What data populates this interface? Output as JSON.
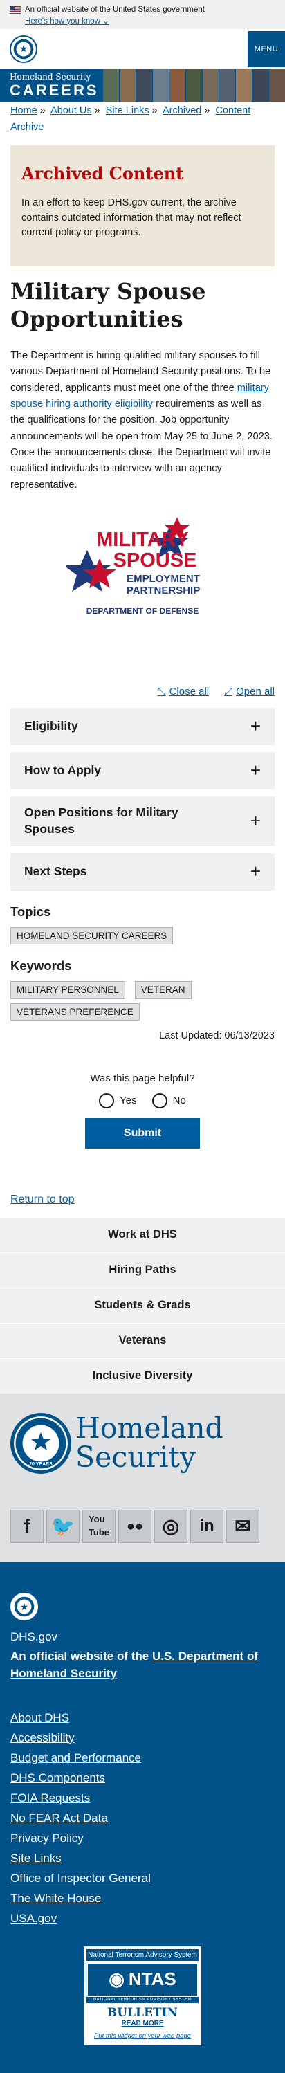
{
  "gov_banner": {
    "text": "An official website of the United States government",
    "link": "Here's how you know"
  },
  "header": {
    "menu": "MENU",
    "small_title": "Homeland Security",
    "careers": "CAREERS"
  },
  "breadcrumb": [
    "Home",
    "About Us",
    "Site Links",
    "Archived",
    "Content Archive"
  ],
  "archive": {
    "title": "Archived Content",
    "text": "In an effort to keep DHS.gov current, the archive contains outdated information that may not reflect current policy or programs."
  },
  "page_title": "Military Spouse Opportunities",
  "lead": {
    "before": "The Department is hiring qualified military spouses to fill various Department of Homeland Security positions. To be considered, applicants must meet one of the three ",
    "link": "military spouse hiring authority eligibility",
    "after": " requirements as well as the qualifications for the position. Job opportunity announcements will be open from May 25 to June 2, 2023. Once the announcements close, the Department will invite qualified individuals to interview with an agency representative."
  },
  "logo": {
    "line1": "MILITARY",
    "line2": "SPOUSE",
    "line3": "EMPLOYMENT",
    "line4": "PARTNERSHIP",
    "line5": "DEPARTMENT OF DEFENSE"
  },
  "accordion": {
    "close_all": "Close all",
    "open_all": "Open all",
    "items": [
      "Eligibility",
      "How to Apply",
      "Open Positions for Military Spouses",
      "Next Steps"
    ]
  },
  "topics": {
    "heading": "Topics",
    "tags": [
      "HOMELAND SECURITY CAREERS"
    ]
  },
  "keywords": {
    "heading": "Keywords",
    "tags": [
      "MILITARY PERSONNEL",
      "VETERAN",
      "VETERANS PREFERENCE"
    ]
  },
  "updated": "Last Updated: 06/13/2023",
  "feedback": {
    "question": "Was this page helpful?",
    "yes": "Yes",
    "no": "No",
    "submit": "Submit"
  },
  "return_top": "Return to top",
  "footer_nav": [
    "Work at DHS",
    "Hiring Paths",
    "Students & Grads",
    "Veterans",
    "Inclusive Diversity"
  ],
  "footer_logo": {
    "line1": "Homeland",
    "line2": "Security",
    "years": "20 YEARS"
  },
  "social": [
    "facebook-icon",
    "twitter-icon",
    "youtube-icon",
    "flickr-icon",
    "instagram-icon",
    "linkedin-icon",
    "email-icon"
  ],
  "blue_footer": {
    "dhs": "DHS.gov",
    "official_before": "An official website of the ",
    "official_link": "U.S. Department of Homeland Security",
    "links": [
      "About DHS",
      "Accessibility",
      "Budget and Performance",
      "DHS Components",
      "FOIA Requests",
      "No FEAR Act Data",
      "Privacy Policy",
      "Site Links",
      "Office of Inspector General",
      "The White House",
      "USA.gov"
    ]
  },
  "ntas": {
    "top": "National Terrorism Advisory System",
    "name": "NTAS",
    "sub": "NATIONAL TERRORISM ADVISORY SYSTEM",
    "bulletin": "BULLETIN",
    "read_more": "READ MORE",
    "put": "Put this widget on your web page"
  },
  "colors": {
    "dhs_blue": "#005288",
    "link_blue": "#005ea2",
    "archive_red": "#b50909",
    "archive_bg": "#ede7da"
  }
}
